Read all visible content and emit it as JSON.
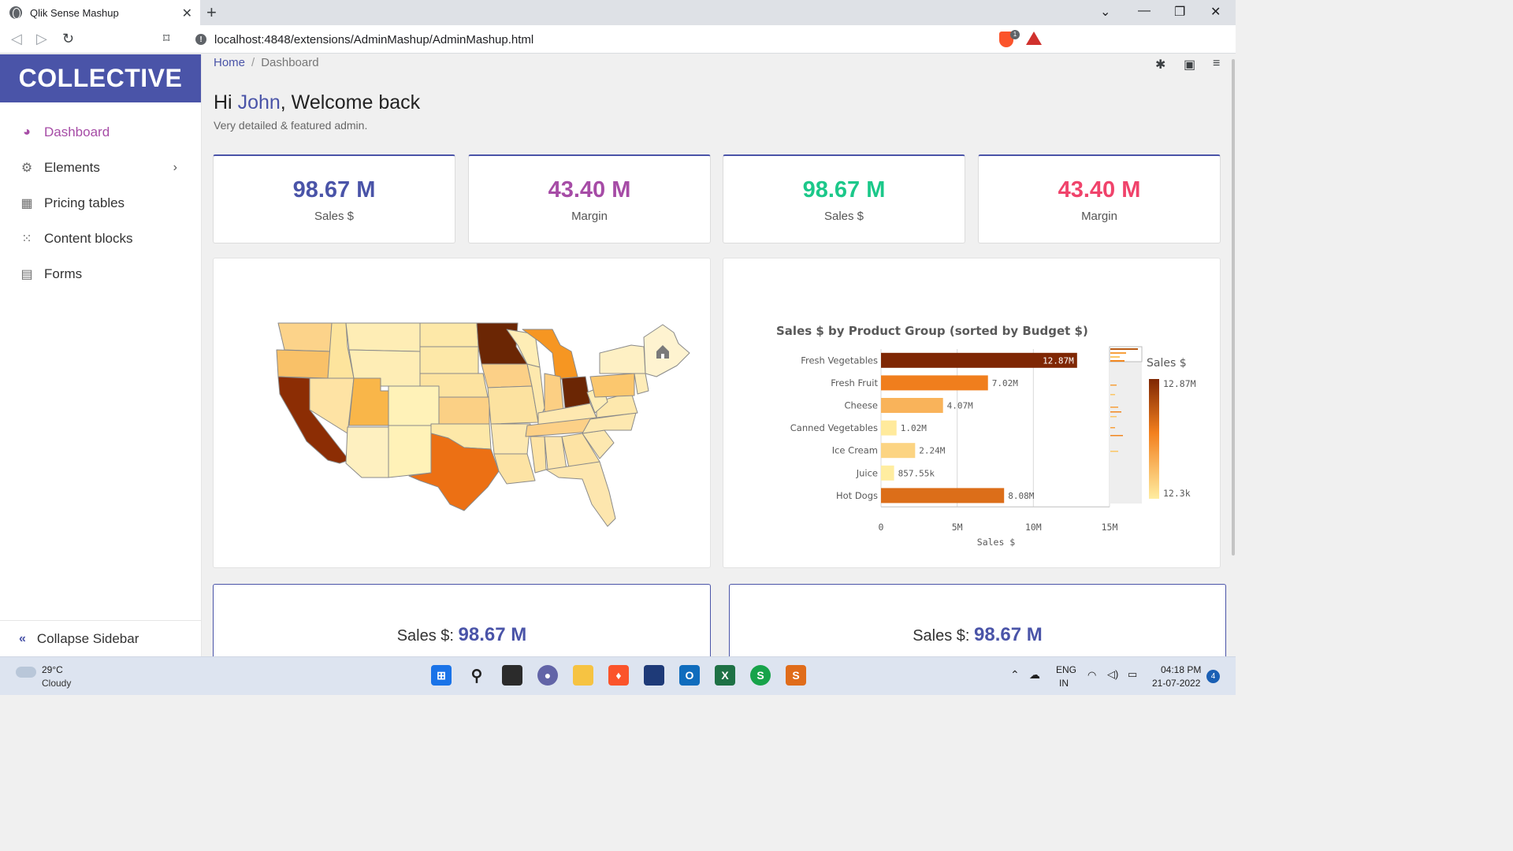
{
  "browser": {
    "tab_title": "Qlik Sense Mashup",
    "tab_close": "✕",
    "new_tab": "+",
    "url": "localhost:4848/extensions/AdminMashup/AdminMashup.html",
    "shield_count": "1"
  },
  "sidebar": {
    "logo": "COLLECTIVE",
    "items": [
      {
        "label": "Dashboard",
        "icon": "palette-icon"
      },
      {
        "label": "Elements",
        "icon": "cogs-icon"
      },
      {
        "label": "Pricing tables",
        "icon": "table-icon"
      },
      {
        "label": "Content blocks",
        "icon": "grid-icon"
      },
      {
        "label": "Forms",
        "icon": "document-icon"
      }
    ],
    "collapse_label": "Collapse Sidebar"
  },
  "breadcrumb": {
    "home": "Home",
    "sep": "/",
    "current": "Dashboard"
  },
  "greeting": {
    "prefix": "Hi ",
    "name": "John",
    "suffix": ", Welcome back",
    "subtitle": "Very detailed & featured admin."
  },
  "kpis": [
    {
      "value": "98.67 M",
      "label": "Sales $",
      "color": "#4a54a8"
    },
    {
      "value": "43.40 M",
      "label": "Margin",
      "color": "#a64ca6"
    },
    {
      "value": "98.67 M",
      "label": "Sales $",
      "color": "#1cc88a"
    },
    {
      "value": "43.40 M",
      "label": "Margin",
      "color": "#f0436b"
    }
  ],
  "chart_data": {
    "type": "bar",
    "orientation": "horizontal",
    "title": "Sales $ by Product Group (sorted by Budget $)",
    "xlabel": "Sales $",
    "categories": [
      "Fresh Vegetables",
      "Fresh Fruit",
      "Cheese",
      "Canned Vegetables",
      "Ice Cream",
      "Juice",
      "Hot Dogs"
    ],
    "values": [
      12870000,
      7020000,
      4070000,
      1020000,
      2240000,
      857550,
      8080000
    ],
    "value_labels": [
      "12.87M",
      "7.02M",
      "4.07M",
      "1.02M",
      "2.24M",
      "857.55k",
      "8.08M"
    ],
    "xlim": [
      0,
      15000000
    ],
    "xticks": [
      "0",
      "5M",
      "10M",
      "15M"
    ],
    "legend_title": "Sales $",
    "legend_max": "12.87M",
    "legend_min": "12.3k",
    "grid": true
  },
  "bottom_cards": [
    {
      "label": "Sales $: ",
      "value": "98.67 M"
    },
    {
      "label": "Sales $: ",
      "value": "98.67 M"
    }
  ],
  "taskbar": {
    "temp": "29°C",
    "weather": "Cloudy",
    "lang": "ENG",
    "region": "IN",
    "time": "04:18 PM",
    "date": "21-07-2022",
    "notifications": "4"
  }
}
